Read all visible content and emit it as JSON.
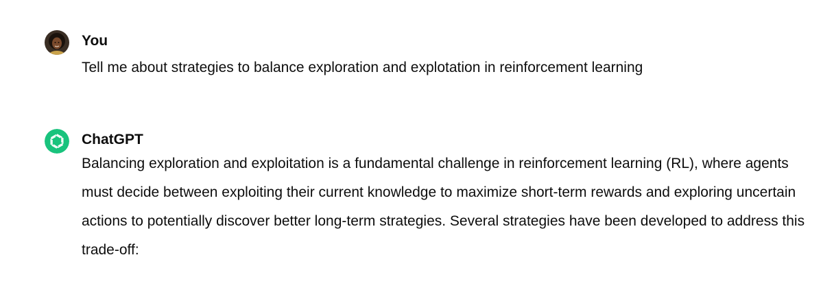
{
  "conversation": {
    "user_message": {
      "author": "You",
      "avatar_icon": "user-avatar-photo",
      "text": "Tell me about strategies to balance exploration and explotation in reinforcement learning"
    },
    "assistant_message": {
      "author": "ChatGPT",
      "avatar_icon": "openai-logo-icon",
      "avatar_color": "#19c37d",
      "text": "Balancing exploration and exploitation is a fundamental challenge in reinforcement learning (RL), where agents must decide between exploiting their current knowledge to maximize short-term rewards and exploring uncertain actions to potentially discover better long-term strategies. Several strategies have been developed to address this trade-off:"
    }
  }
}
